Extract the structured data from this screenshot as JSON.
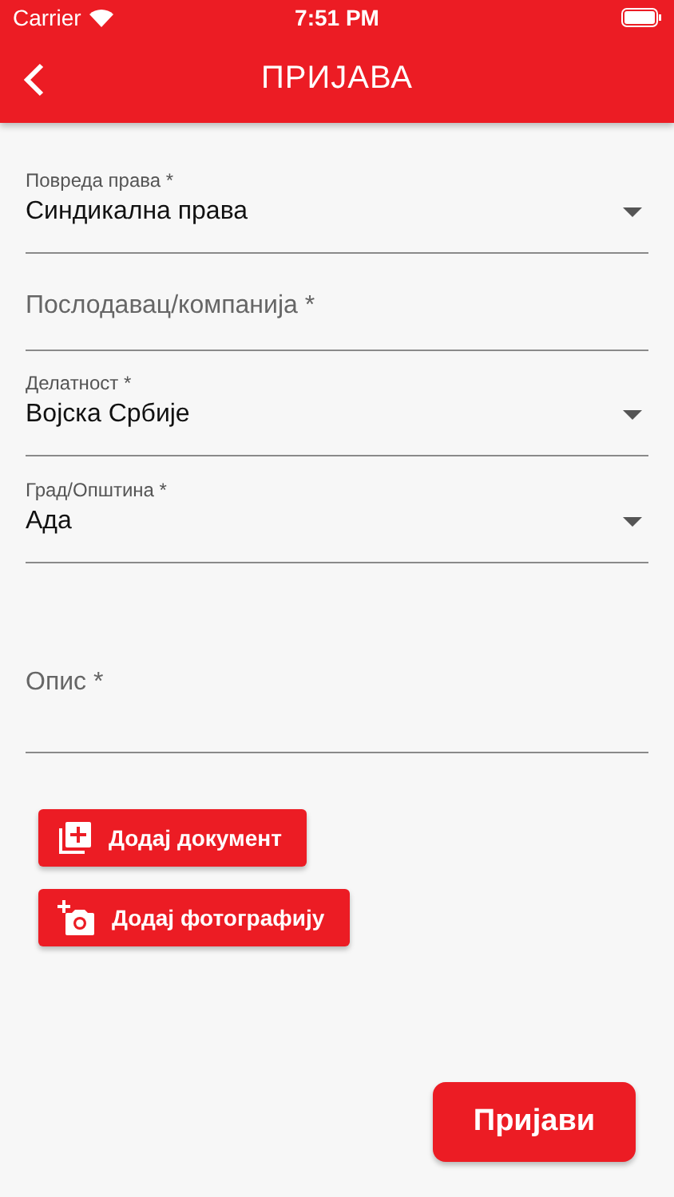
{
  "status_bar": {
    "carrier": "Carrier",
    "time": "7:51 PM"
  },
  "header": {
    "title": "ПРИЈАВА"
  },
  "fields": [
    {
      "kind": "select",
      "label": "Повреда права *",
      "value": "Синдикална права"
    },
    {
      "kind": "text",
      "placeholder": "Послодавац/компанија *"
    },
    {
      "kind": "select",
      "label": "Делатност *",
      "value": "Војска Србије"
    },
    {
      "kind": "select",
      "label": "Град/Општина *",
      "value": "Ада"
    },
    {
      "kind": "textarea",
      "placeholder": "Опис *"
    }
  ],
  "attach_buttons": [
    {
      "kind": "document",
      "label": "Додај документ"
    },
    {
      "kind": "photo",
      "label": "Додај фотографију"
    }
  ],
  "submit": {
    "label": "Пријави"
  }
}
